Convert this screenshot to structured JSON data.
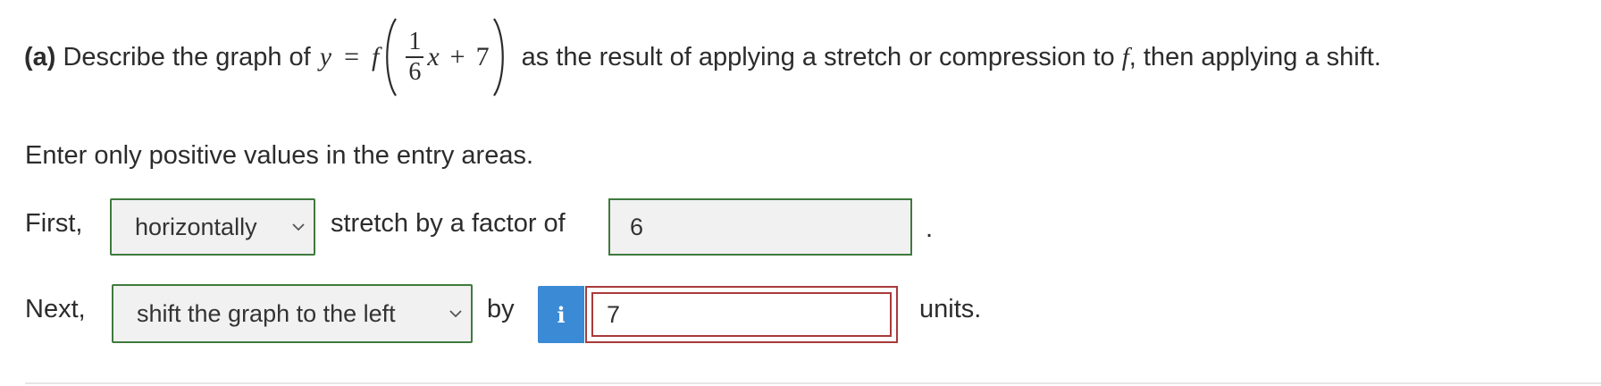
{
  "question": {
    "part_label": "(a)",
    "text_before": "Describe the graph of",
    "equation": {
      "lhs": "y",
      "equals": "=",
      "func": "f",
      "fraction_numerator": "1",
      "fraction_denominator": "6",
      "variable": "x",
      "plus": "+",
      "constant": "7"
    },
    "text_middle": "as the result of applying a stretch or compression to",
    "func_ref": "f",
    "text_after": ", then applying a shift."
  },
  "instruction": "Enter only positive values in the entry areas.",
  "row1": {
    "label": "First,",
    "select_value": "horizontally",
    "connector": "stretch by a factor of",
    "input_value": "6",
    "trailing": "."
  },
  "row2": {
    "label": "Next,",
    "select_value": "shift the graph to the left",
    "connector": "by",
    "info_icon": "info-icon",
    "input_value": "7",
    "trailing": "units."
  },
  "colors": {
    "valid_border": "#3f7a3d",
    "error_border": "#a93a3a",
    "info_button": "#3a8ad6"
  }
}
